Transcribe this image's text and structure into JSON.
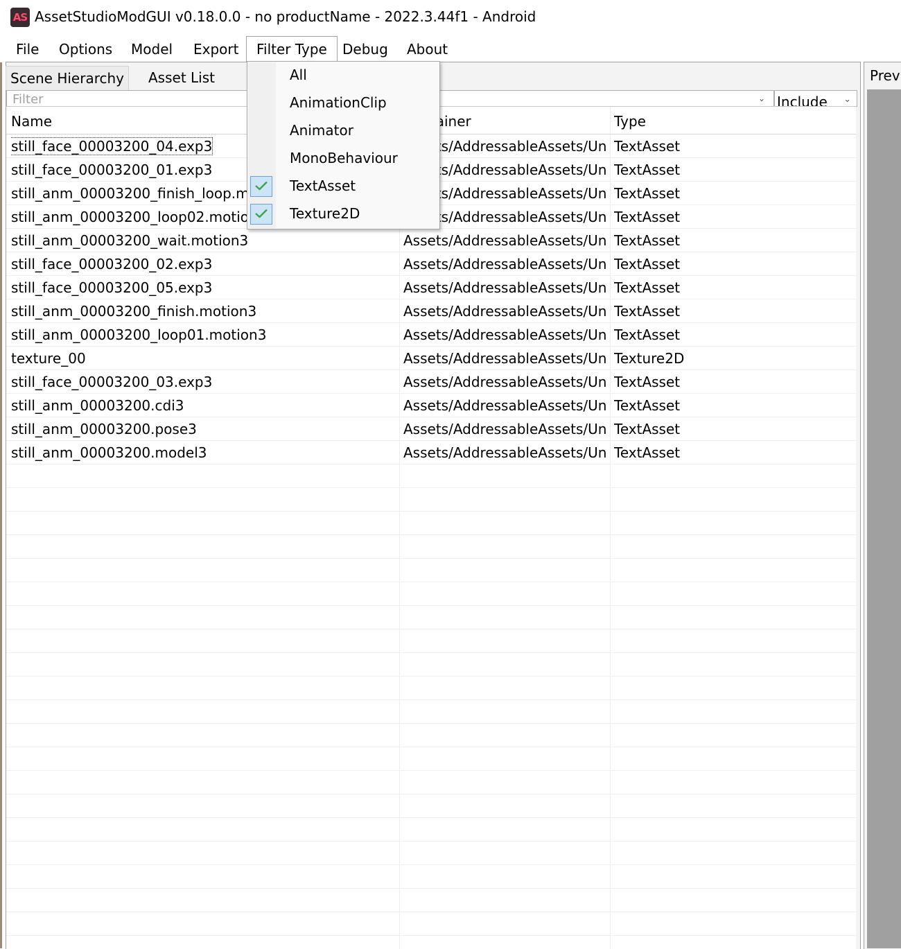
{
  "window": {
    "icon_text": "AS",
    "title": "AssetStudioModGUI v0.18.0.0 - no productName - 2022.3.44f1 - Android"
  },
  "menu": {
    "file": "File",
    "options": "Options",
    "model": "Model",
    "export": "Export",
    "filter_type": "Filter Type",
    "debug": "Debug",
    "about": "About"
  },
  "tabs": {
    "scene_hierarchy": "Scene Hierarchy",
    "asset_list": "Asset List"
  },
  "filter": {
    "placeholder": "Filter",
    "mode": "Include"
  },
  "columns": {
    "name": "Name",
    "container": "Container",
    "type": "Type"
  },
  "rows": [
    {
      "name": "still_face_00003200_04.exp3",
      "container": "Assets/AddressableAssets/Un...",
      "type": "TextAsset"
    },
    {
      "name": "still_face_00003200_01.exp3",
      "container": "Assets/AddressableAssets/Un...",
      "type": "TextAsset"
    },
    {
      "name": "still_anm_00003200_finish_loop.motion3",
      "container": "Assets/AddressableAssets/Un...",
      "type": "TextAsset"
    },
    {
      "name": "still_anm_00003200_loop02.motion3",
      "container": "Assets/AddressableAssets/Un...",
      "type": "TextAsset"
    },
    {
      "name": "still_anm_00003200_wait.motion3",
      "container": "Assets/AddressableAssets/Un...",
      "type": "TextAsset"
    },
    {
      "name": "still_face_00003200_02.exp3",
      "container": "Assets/AddressableAssets/Un...",
      "type": "TextAsset"
    },
    {
      "name": "still_face_00003200_05.exp3",
      "container": "Assets/AddressableAssets/Un...",
      "type": "TextAsset"
    },
    {
      "name": "still_anm_00003200_finish.motion3",
      "container": "Assets/AddressableAssets/Un...",
      "type": "TextAsset"
    },
    {
      "name": "still_anm_00003200_loop01.motion3",
      "container": "Assets/AddressableAssets/Un...",
      "type": "TextAsset"
    },
    {
      "name": "texture_00",
      "container": "Assets/AddressableAssets/Un...",
      "type": "Texture2D"
    },
    {
      "name": "still_face_00003200_03.exp3",
      "container": "Assets/AddressableAssets/Un...",
      "type": "TextAsset"
    },
    {
      "name": "still_anm_00003200.cdi3",
      "container": "Assets/AddressableAssets/Un...",
      "type": "TextAsset"
    },
    {
      "name": "still_anm_00003200.pose3",
      "container": "Assets/AddressableAssets/Un...",
      "type": "TextAsset"
    },
    {
      "name": "still_anm_00003200.model3",
      "container": "Assets/AddressableAssets/Un...",
      "type": "TextAsset"
    }
  ],
  "filter_type_menu": [
    {
      "label": "All",
      "checked": false
    },
    {
      "label": "AnimationClip",
      "checked": false
    },
    {
      "label": "Animator",
      "checked": false
    },
    {
      "label": "MonoBehaviour",
      "checked": false
    },
    {
      "label": "TextAsset",
      "checked": true
    },
    {
      "label": "Texture2D",
      "checked": true
    }
  ],
  "preview": {
    "label": "Preview"
  },
  "colors": {
    "check_fill": "#cde4f7",
    "check_mark": "#3aa64a",
    "icon_accent": "#ff4a6a"
  }
}
